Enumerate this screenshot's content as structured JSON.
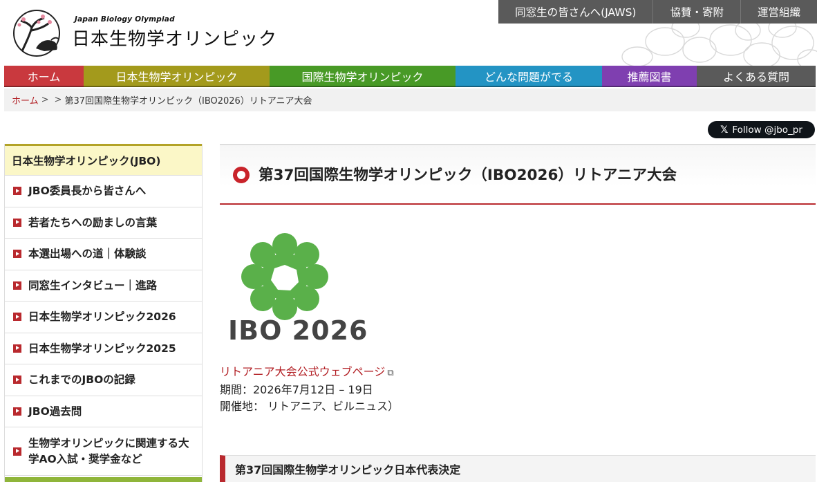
{
  "header": {
    "logo_en": "Japan Biology Olympiad",
    "logo_jp": "日本生物学オリンピック",
    "util_nav": [
      {
        "label": "同窓生の皆さんへ(JAWS)"
      },
      {
        "label": "協賛・寄附"
      },
      {
        "label": "運営組織"
      }
    ]
  },
  "main_nav": [
    {
      "label": "ホーム",
      "color": "#c9393e"
    },
    {
      "label": "日本生物学オリンピック",
      "color": "#a39a1c"
    },
    {
      "label": "国際生物学オリンピック",
      "color": "#489a26"
    },
    {
      "label": "どんな問題がでる",
      "color": "#2394c4"
    },
    {
      "label": "推薦図書",
      "color": "#7f3fb0"
    },
    {
      "label": "よくある質問",
      "color": "#5a5a5a"
    }
  ],
  "breadcrumb": {
    "home": "ホーム",
    "sep1": ">",
    "sep2": ">",
    "current": "第37回国際生物学オリンピック（IBO2026）リトアニア大会"
  },
  "follow": {
    "label": "Follow @jbo_pr"
  },
  "sidebar": {
    "heading": "日本生物学オリンピック(JBO)",
    "items": [
      {
        "label": "JBO委員長から皆さんへ"
      },
      {
        "label": "若者たちへの励ましの言葉"
      },
      {
        "label": "本選出場への道｜体験談"
      },
      {
        "label": "同窓生インタビュー｜進路"
      },
      {
        "label": "日本生物学オリンピック2026"
      },
      {
        "label": "日本生物学オリンピック2025"
      },
      {
        "label": "これまでのJBOの記録"
      },
      {
        "label": "JBO過去問"
      },
      {
        "label": "生物学オリンピックに関連する大学AO入試・奨学金など"
      }
    ]
  },
  "content": {
    "title": "第37回国際生物学オリンピック（IBO2026）リトアニア大会",
    "logo_text": "IBO 2026",
    "official_link": "リトアニア大会公式ウェブページ",
    "period": "期間：2026年7月12日 – 19日",
    "venue": "開催地： リトアニア、ビルニュス）",
    "subheading": "第37回国際生物学オリンピック日本代表決定"
  },
  "colors": {
    "accent_red": "#b9292e",
    "logo_green": "#5ab04a"
  }
}
